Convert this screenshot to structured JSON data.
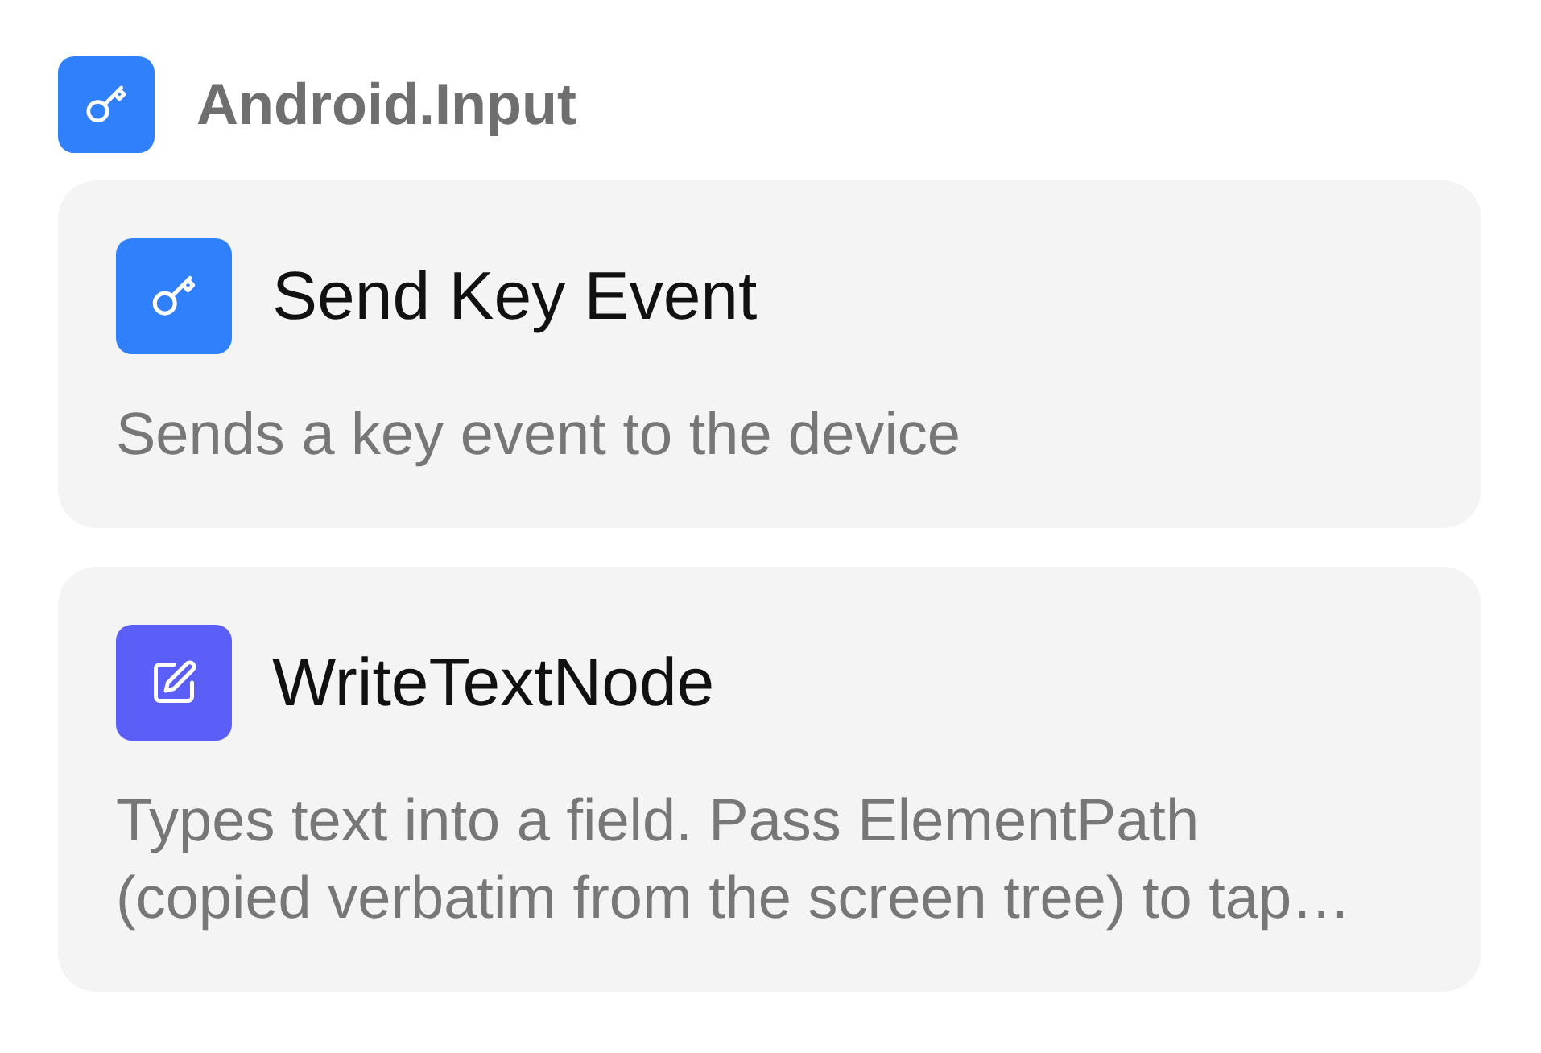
{
  "group": {
    "title": "Android.Input",
    "kind": "key",
    "color": "#2f80fa"
  },
  "nodes": [
    {
      "title": "Send Key Event",
      "description": "Sends a key event to the device",
      "kind": "key",
      "color": "#2f80fa"
    },
    {
      "title": "WriteTextNode",
      "description": "Types text into a field. Pass ElementPath (copied verbatim from the screen tree) to tap…",
      "kind": "edit",
      "color": "#5b5ef7"
    }
  ]
}
